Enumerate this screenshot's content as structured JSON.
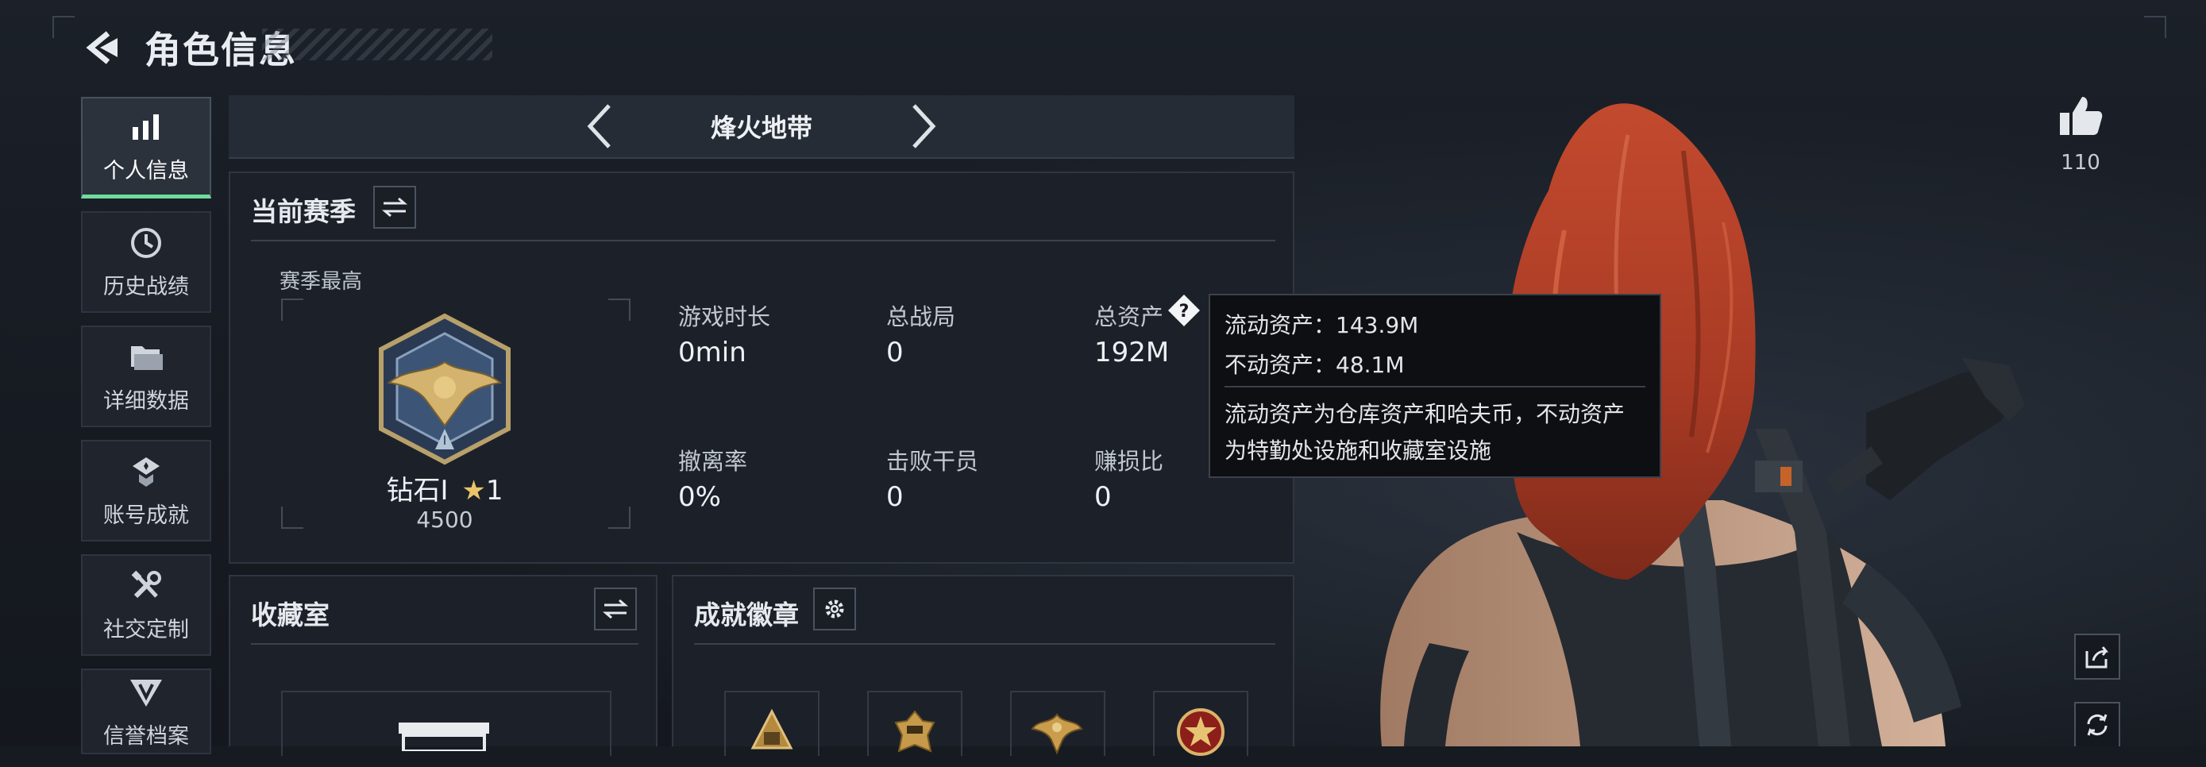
{
  "header": {
    "title": "角色信息",
    "back_icon": "back-arrow-icon"
  },
  "sidebar": {
    "active_color": "#6fdca0",
    "items": [
      {
        "label": "个人信息",
        "icon": "bar-chart-icon",
        "active": true
      },
      {
        "label": "历史战绩",
        "icon": "clock-icon",
        "active": false
      },
      {
        "label": "详细数据",
        "icon": "folder-icon",
        "active": false
      },
      {
        "label": "账号成就",
        "icon": "achievement-icon",
        "active": false
      },
      {
        "label": "社交定制",
        "icon": "tools-icon",
        "active": false
      },
      {
        "label": "信誉档案",
        "icon": "badge-icon",
        "active": false
      }
    ]
  },
  "mode_selector": {
    "name": "烽火地带"
  },
  "season_panel": {
    "title": "当前赛季",
    "best_label": "赛季最高",
    "rank": {
      "name": "钻石Ⅰ",
      "stars": "1",
      "score": "4500"
    },
    "stats": [
      {
        "label": "游戏时长",
        "value": "0min"
      },
      {
        "label": "总战局",
        "value": "0"
      },
      {
        "label": "总资产",
        "value": "192M"
      },
      {
        "label": "撤离率",
        "value": "0%"
      },
      {
        "label": "击败干员",
        "value": "0"
      },
      {
        "label": "赚损比",
        "value": "0"
      }
    ]
  },
  "tooltip": {
    "liquid": "流动资产：143.9M",
    "fixed": "不动资产：48.1M",
    "desc_line1": "流动资产为仓库资产和哈夫币，不动资产",
    "desc_line2": "为特勤处设施和收藏室设施"
  },
  "collection_panel": {
    "title": "收藏室"
  },
  "achievement_panel": {
    "title": "成就徽章"
  },
  "right": {
    "like_count": "110"
  }
}
